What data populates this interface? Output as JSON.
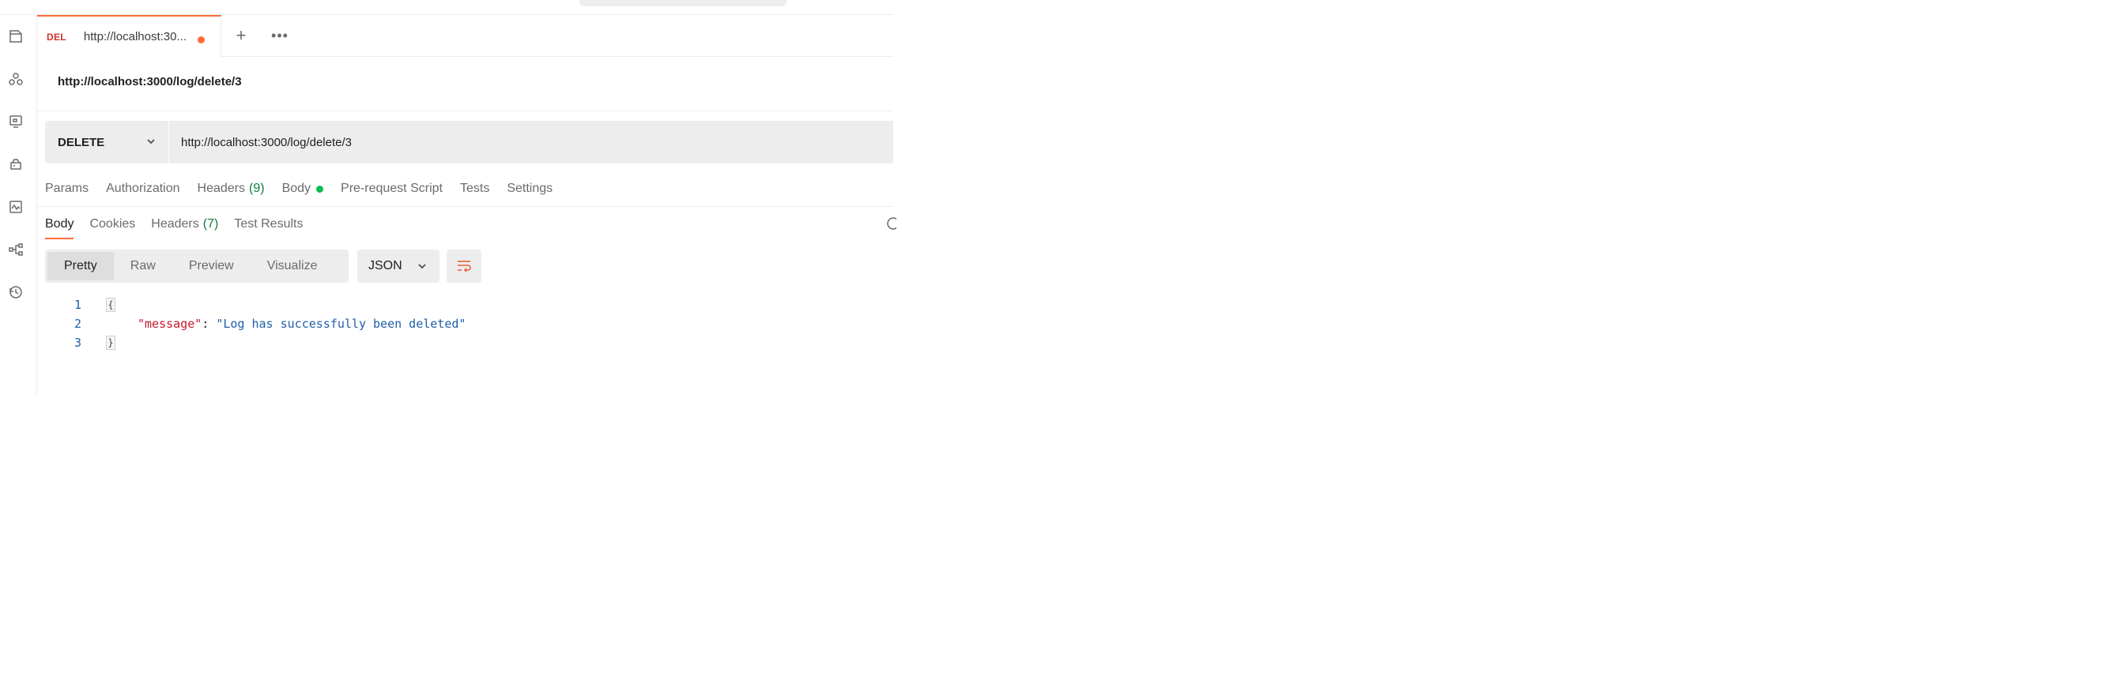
{
  "tab": {
    "method": "DEL",
    "title": "http://localhost:30..."
  },
  "tabbar": {
    "plus_label": "+",
    "more_label": "•••"
  },
  "request": {
    "title": "http://localhost:3000/log/delete/3",
    "method": "DELETE",
    "url": "http://localhost:3000/log/delete/3"
  },
  "request_tabs": [
    {
      "label": "Params"
    },
    {
      "label": "Authorization"
    },
    {
      "label": "Headers",
      "count": "(9)"
    },
    {
      "label": "Body"
    },
    {
      "label": "Pre-request Script"
    },
    {
      "label": "Tests"
    },
    {
      "label": "Settings"
    }
  ],
  "response_tabs": [
    {
      "label": "Body"
    },
    {
      "label": "Cookies"
    },
    {
      "label": "Headers",
      "count": "(7)"
    },
    {
      "label": "Test Results"
    }
  ],
  "view_modes": [
    "Pretty",
    "Raw",
    "Preview",
    "Visualize"
  ],
  "format": "JSON",
  "code": {
    "lines": [
      {
        "num": "1",
        "text": "{"
      },
      {
        "num": "2",
        "key": "\"message\"",
        "sep": ": ",
        "value": "\"Log has successfully been deleted\""
      },
      {
        "num": "3",
        "text": "}"
      }
    ]
  },
  "colors": {
    "accent": "#ff6c37",
    "method_delete": "#d32f2f",
    "count_green": "#0f7b3e",
    "json_key": "#c3192a",
    "json_string": "#1f5fa8"
  },
  "icons": {
    "sidebar": [
      "collections-icon",
      "apis-icon",
      "environments-icon",
      "mock-servers-icon",
      "monitors-icon",
      "flows-icon",
      "history-icon"
    ]
  }
}
